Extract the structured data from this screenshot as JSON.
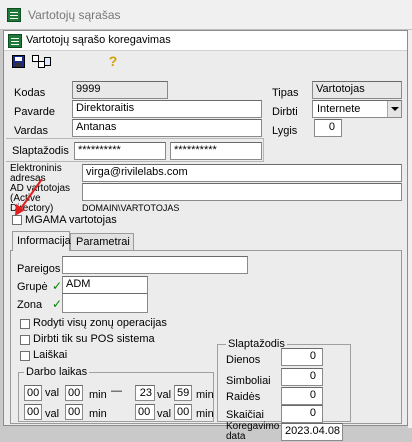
{
  "outer_window": {
    "title": "Vartotojų sąrašas"
  },
  "dialog": {
    "title": "Vartotojų sąrašo koregavimas"
  },
  "form": {
    "kodas": {
      "label": "Kodas",
      "value": "9999"
    },
    "pavarde": {
      "label": "Pavarde",
      "value": "Direktoraitis"
    },
    "vardas": {
      "label": "Vardas",
      "value": "Antanas"
    },
    "tipas": {
      "label": "Tipas",
      "value": "Vartotojas"
    },
    "dirbti": {
      "label": "Dirbti",
      "value": "Internete"
    },
    "lygis": {
      "label": "Lygis",
      "value": "0"
    },
    "slaptazodis": {
      "label": "Slaptažodis",
      "value1": "**********",
      "value2": "**********"
    },
    "email": {
      "label": "Elektroninis adresas",
      "value": "virga@rivilelabs.com"
    },
    "ad": {
      "label": "AD vartotojas (Active Directory)",
      "value": "",
      "hint": "DOMAIN\\VARTOTOJAS"
    },
    "mgama": {
      "label": "MGAMA vartotojas"
    }
  },
  "tabs": {
    "info": "Informacija",
    "params": "Parametrai"
  },
  "info": {
    "pareigos": {
      "label": "Pareigos",
      "value": ""
    },
    "grupe": {
      "label": "Grupė",
      "value": "ADM"
    },
    "zona": {
      "label": "Zona",
      "value": ""
    },
    "check1": "Rodyti visų zonų operacijas",
    "check2": "Dirbti tik su POS sistema",
    "check3": "Laiškai",
    "darbo_laikas": {
      "label": "Darbo laikas",
      "val": "val",
      "min": "min",
      "dash": "—",
      "row1": [
        "00",
        "00",
        "23",
        "59"
      ],
      "row2": [
        "00",
        "00",
        "00",
        "00"
      ]
    },
    "slaptazodis_group": {
      "label": "Slaptažodis",
      "dienos": {
        "label": "Dienos",
        "value": "0"
      },
      "simboliai": {
        "label": "Simboliai",
        "value": "0"
      },
      "raides": {
        "label": "Raidės",
        "value": "0"
      },
      "skaiciai": {
        "label": "Skaičiai",
        "value": "0"
      },
      "koregavimo": {
        "label1": "Koregavimo",
        "label2": "data",
        "value": "2023.04.08"
      }
    }
  },
  "colors": {
    "titlebar_top": "#ffffff",
    "titlebar_text": "#000000",
    "arrow": "#e02020",
    "check": "#008000"
  }
}
